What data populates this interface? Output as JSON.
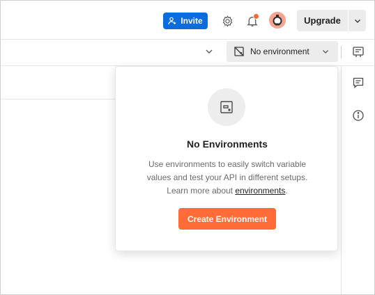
{
  "header": {
    "invite_label": "Invite",
    "upgrade_label": "Upgrade"
  },
  "environment": {
    "selected": "No environment"
  },
  "popover": {
    "title": "No Environments",
    "desc_line1": "Use environments to easily switch variable",
    "desc_line2": "values and test your API in different setups.",
    "desc_learn": "Learn more about ",
    "desc_link": "environments",
    "desc_end": ".",
    "create_label": "Create Environment"
  },
  "colors": {
    "invite": "#0c6cde",
    "create": "#ff6c37",
    "notification": "#f26b3a"
  },
  "icons": [
    "person-add-icon",
    "settings-icon",
    "bell-icon",
    "avatar-icon",
    "chevron-down-icon",
    "no-environment-icon",
    "environment-quicklook-icon",
    "comment-icon",
    "info-icon"
  ]
}
